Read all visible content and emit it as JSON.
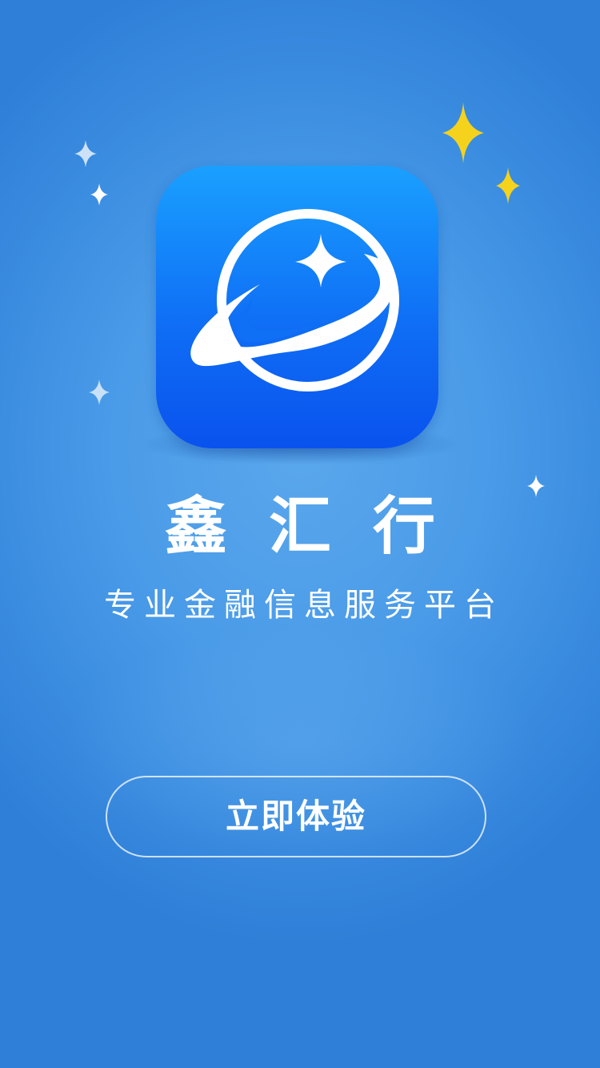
{
  "app": {
    "name": "鑫汇行",
    "tagline": "专业金融信息服务平台",
    "logo_icon": "planet-star-icon"
  },
  "actions": {
    "start_label": "立即体验"
  },
  "colors": {
    "background": "#4a9be8",
    "icon_top": "#1aa0ff",
    "icon_bottom": "#0a52ee",
    "star_gold": "#f5d21c",
    "text": "#ffffff"
  },
  "decorations": [
    "sparkle-star-icon",
    "gold-star-icon"
  ]
}
